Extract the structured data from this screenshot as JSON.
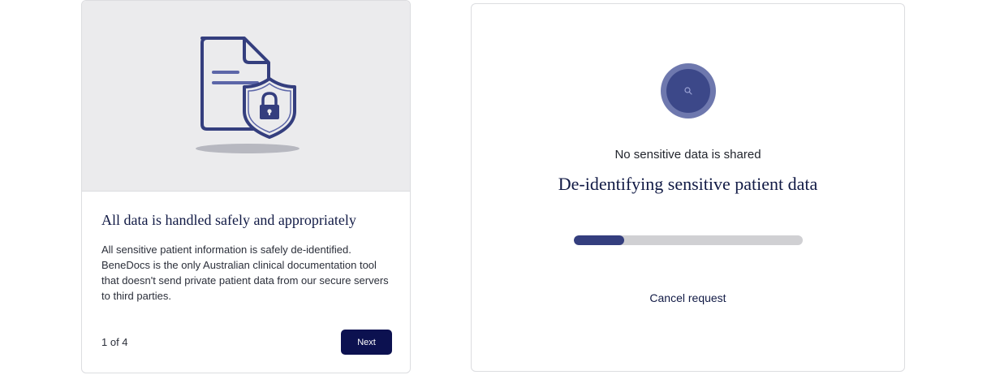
{
  "info_card": {
    "illustration_icon": "document-shield-lock-icon",
    "title": "All data is handled safely and appropriately",
    "body": "All sensitive patient information is safely de-identified. BeneDocs is the only Australian clinical documentation tool that doesn't send private patient data from our secure servers to third parties.",
    "pager": "1 of 4",
    "next_label": "Next"
  },
  "progress_card": {
    "spinner_icon": "search-icon",
    "subtitle": "No sensitive data is shared",
    "title": "De-identifying sensitive patient data",
    "progress_fraction": 0.22,
    "cancel_label": "Cancel request"
  },
  "colors": {
    "primary_navy": "#0c1150",
    "spinner_outer": "#6e78ae",
    "spinner_inner": "#3c4889",
    "progress_fill": "#343e7e",
    "progress_track": "#d0d0d3",
    "illustration_bg": "#ebebed"
  }
}
